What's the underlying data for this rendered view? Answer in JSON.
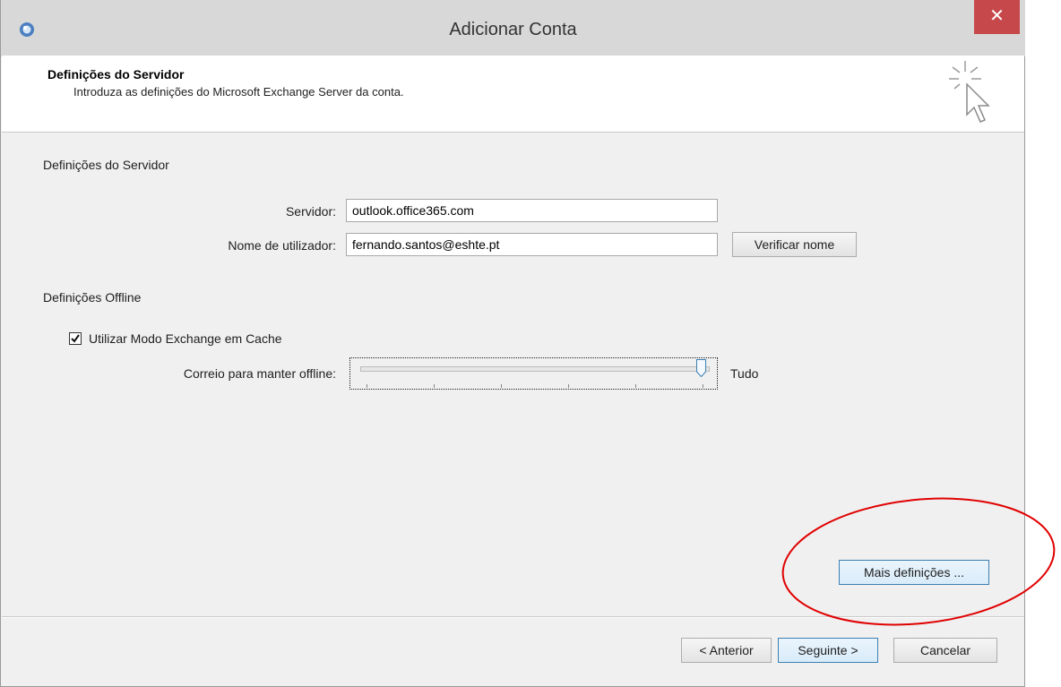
{
  "window": {
    "title": "Adicionar Conta",
    "close_label": "✕",
    "app_icon": "outlook-app-icon"
  },
  "header": {
    "title": "Definições do Servidor",
    "subtitle": "Introduza as definições do Microsoft Exchange Server da conta.",
    "graphic": "cursor-sparkle-icon"
  },
  "server_section": {
    "heading": "Definições do Servidor",
    "server_label": "Servidor:",
    "server_value": "outlook.office365.com",
    "username_label": "Nome de utilizador:",
    "username_value": "fernando.santos@eshte.pt",
    "verify_button": "Verificar nome"
  },
  "offline_section": {
    "heading": "Definições Offline",
    "cache_checkbox_label": "Utilizar Modo Exchange em Cache",
    "cache_checked": true,
    "slider_label": "Correio para manter offline:",
    "slider_value_label": "Tudo",
    "slider_level": 1.0
  },
  "more_settings_button": "Mais definições ...",
  "footer": {
    "back_button": "< Anterior",
    "next_button": "Seguinte >",
    "cancel_button": "Cancelar"
  },
  "colors": {
    "close_button": "#c7484a",
    "annotation_circle": "#e00000",
    "default_button_border": "#3c7fb1"
  }
}
